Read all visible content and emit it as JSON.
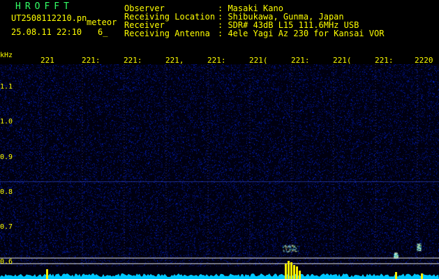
{
  "header": {
    "brand": "HROFFT",
    "filename": "UT2508112210.pn",
    "tag": "meteor",
    "date": "25.08.11 22:10",
    "count": "6_",
    "labels": {
      "observer": "Observer",
      "location": "Receiving Location",
      "receiver": "Receiver",
      "antenna": "Receiving Antenna"
    },
    "values": {
      "observer": ": Masaki Kano",
      "location": ": Shibukawa, Gunma, Japan",
      "receiver": ": SDR# 43dB L15 111.6MHz USB",
      "antenna": ": 4ele Yagi Az 230 for Kansai VOR"
    }
  },
  "time_axis": {
    "ticks": [
      "221",
      "221:",
      "221:",
      "221,",
      "221:",
      "221(",
      "221:",
      "221(",
      "221:",
      "2220"
    ]
  },
  "freq_axis": {
    "unit": "kHz",
    "ticks": [
      "1.1",
      "1.0",
      "0.9",
      "0.8",
      "0.7",
      "0.6"
    ]
  },
  "colors": {
    "bg": "#000000",
    "noise": "#0a1aa0",
    "grid": "#ffffff",
    "text": "#ffff00",
    "brand": "#33ff66",
    "spectrum": "#00d8ff",
    "peak": "#ffff00"
  }
}
